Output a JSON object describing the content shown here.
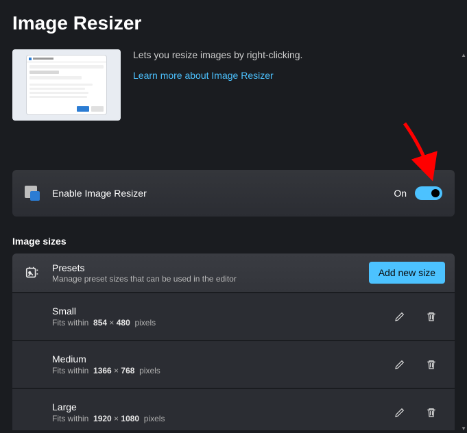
{
  "page": {
    "title": "Image Resizer",
    "description": "Lets you resize images by right-clicking.",
    "learnMoreText": "Learn more about Image Resizer"
  },
  "enable": {
    "label": "Enable Image Resizer",
    "stateText": "On",
    "isOn": true
  },
  "sizes": {
    "sectionLabel": "Image sizes",
    "presets": {
      "title": "Presets",
      "subtitle": "Manage preset sizes that can be used in the editor",
      "addButton": "Add new size"
    },
    "items": [
      {
        "name": "Small",
        "fitPrefix": "Fits within",
        "width": "854",
        "height": "480",
        "unit": "pixels"
      },
      {
        "name": "Medium",
        "fitPrefix": "Fits within",
        "width": "1366",
        "height": "768",
        "unit": "pixels"
      },
      {
        "name": "Large",
        "fitPrefix": "Fits within",
        "width": "1920",
        "height": "1080",
        "unit": "pixels"
      }
    ]
  },
  "colors": {
    "accent": "#4cc2ff",
    "annotationArrow": "#ff0000"
  }
}
